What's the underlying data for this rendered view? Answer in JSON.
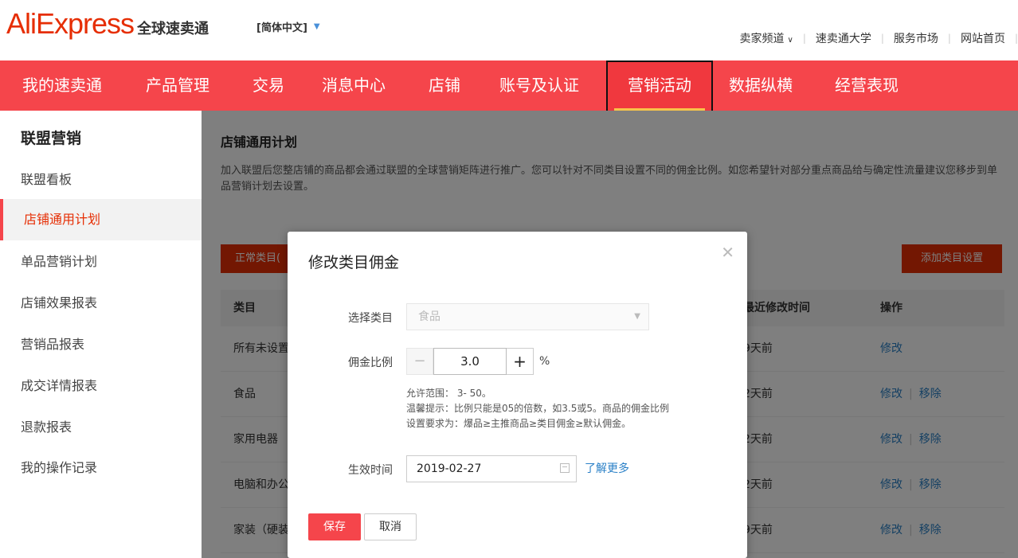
{
  "header": {
    "logo_en": "AliExpress",
    "logo_cn": "全球速卖通",
    "language": "[简体中文]",
    "links": [
      "卖家频道",
      "速卖通大学",
      "服务市场",
      "网站首页"
    ]
  },
  "nav": {
    "items": [
      "我的速卖通",
      "产品管理",
      "交易",
      "消息中心",
      "店铺",
      "账号及认证",
      "营销活动",
      "数据纵横",
      "经营表现"
    ],
    "active": "营销活动"
  },
  "sidebar": {
    "title": "联盟营销",
    "items": [
      "联盟看板",
      "店铺通用计划",
      "单品营销计划",
      "店铺效果报表",
      "营销品报表",
      "成交详情报表",
      "退款报表",
      "我的操作记录"
    ],
    "active": "店铺通用计划"
  },
  "main": {
    "title": "店铺通用计划",
    "description": "加入联盟后您整店铺的商品都会通过联盟的全球营销矩阵进行推广。您可以针对不同类目设置不同的佣金比例。如您希望针对部分重点商品给与确定性流量建议您移步到单品营销计划去设置。",
    "tab_label": "正常类目(",
    "add_button": "添加类目设置",
    "columns": [
      "类目",
      "最近修改时间",
      "操作"
    ],
    "rows": [
      {
        "category": "所有未设置",
        "time": "9天前",
        "ops": [
          "修改"
        ]
      },
      {
        "category": "食品",
        "time": "2天前",
        "ops": [
          "修改",
          "移除"
        ]
      },
      {
        "category": "家用电器",
        "time": "2天前",
        "ops": [
          "修改",
          "移除"
        ]
      },
      {
        "category": "电脑和办公",
        "time": "2天前",
        "ops": [
          "修改",
          "移除"
        ]
      },
      {
        "category": "家装（硬装",
        "time": "9天前",
        "ops": [
          "修改",
          "移除"
        ]
      }
    ]
  },
  "modal": {
    "title": "修改类目佣金",
    "category_label": "选择类目",
    "category_value": "食品",
    "rate_label": "佣金比例",
    "rate_value": "3.0",
    "rate_unit": "%",
    "help_range": "允许范围： 3- 50。",
    "help_tip": "温馨提示：比例只能是05的倍数，如3.5或5。商品的佣金比例",
    "help_rule": "设置要求为：爆品≥主推商品≥类目佣金≥默认佣金。",
    "date_label": "生效时间",
    "date_value": "2019-02-27",
    "learn_more": "了解更多",
    "save": "保存",
    "cancel": "取消"
  },
  "colors": {
    "brand_red": "#f5454b",
    "logo_red": "#e62e04",
    "link_blue": "#2a80c7",
    "active_underline": "#f7c34a"
  }
}
